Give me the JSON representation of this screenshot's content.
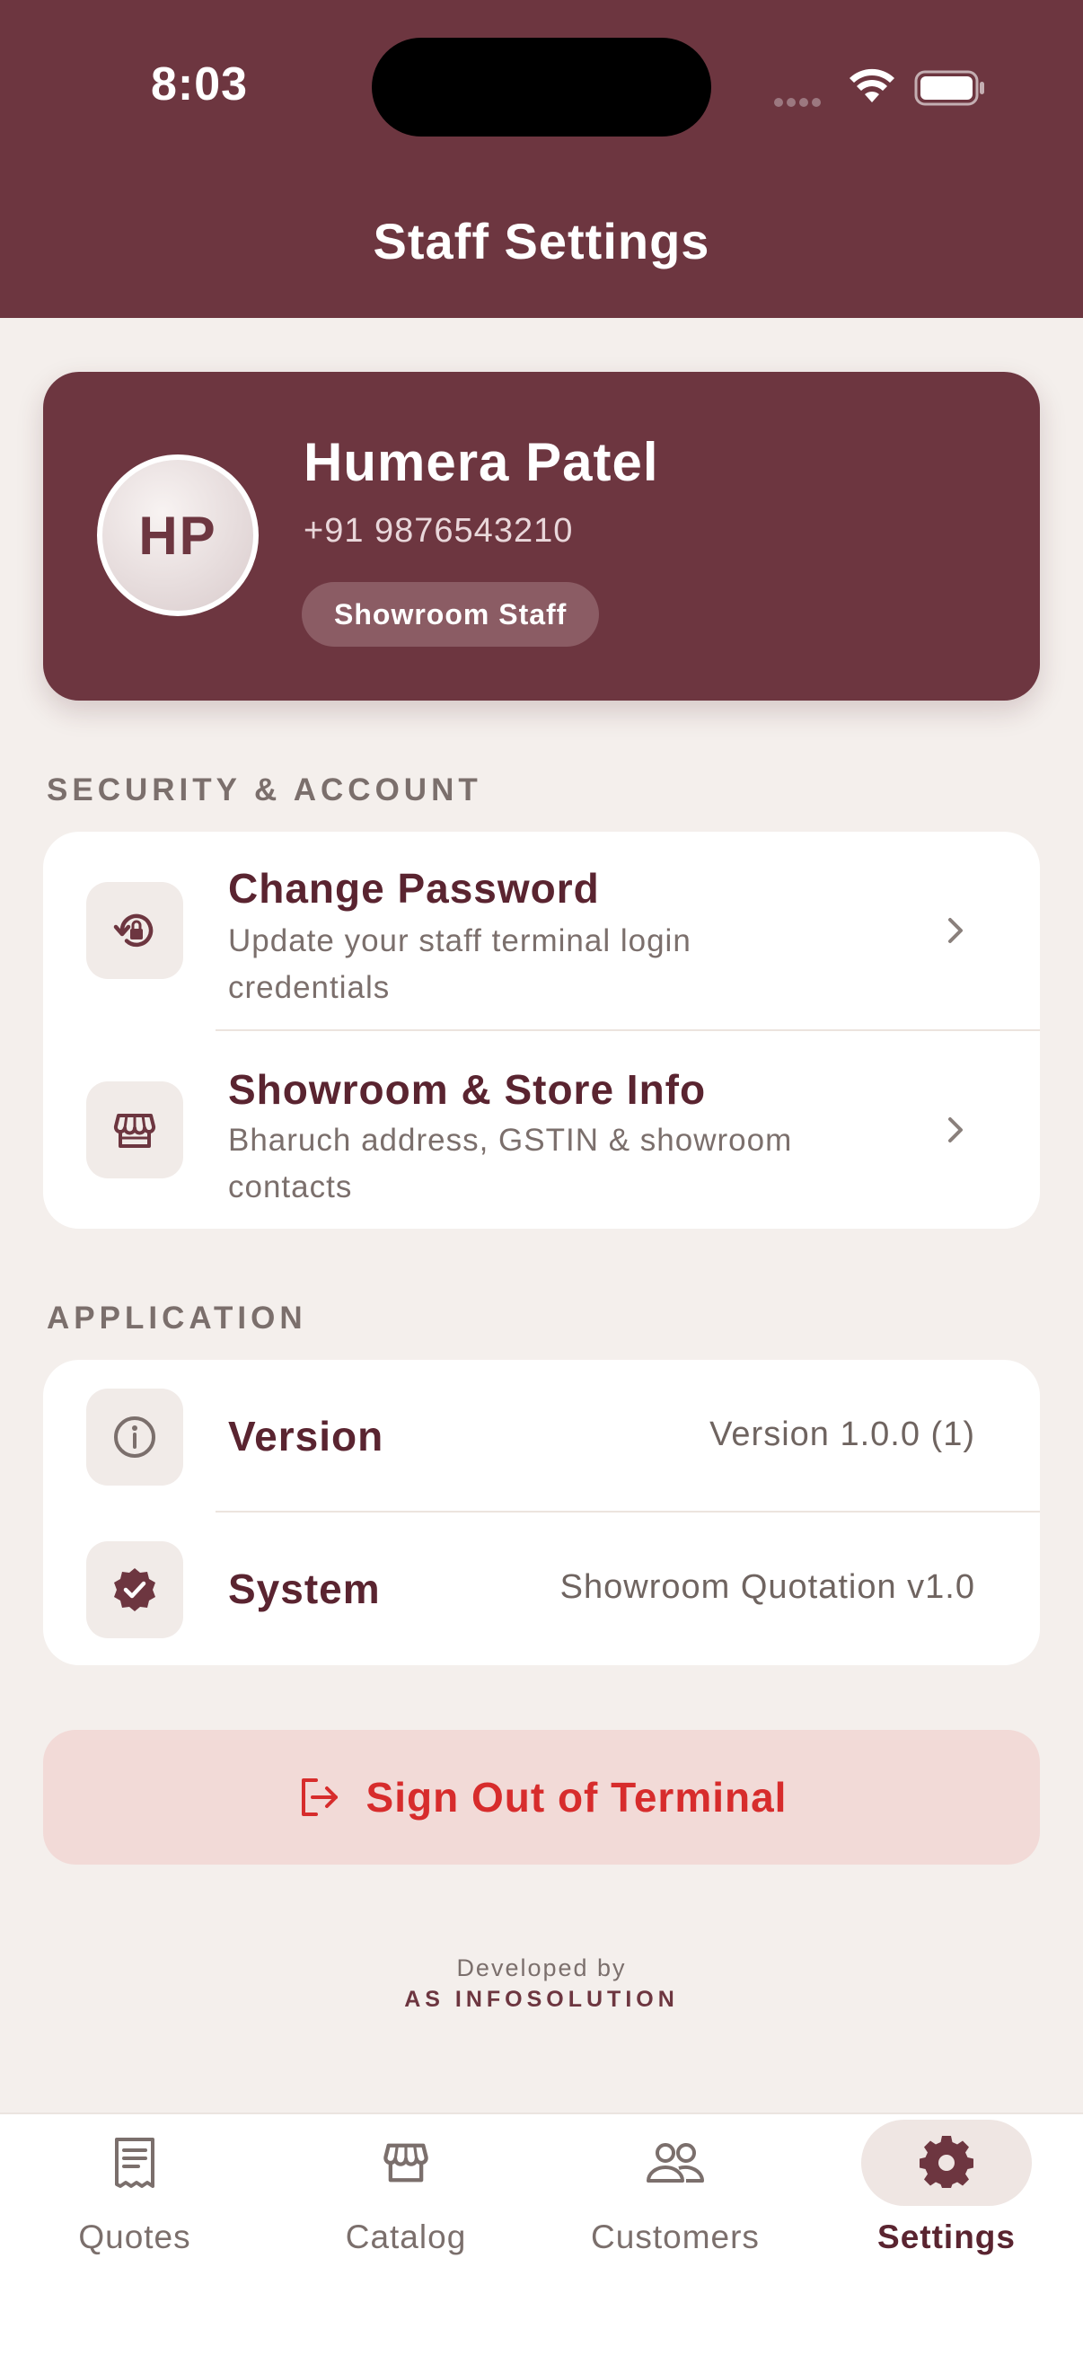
{
  "status_bar": {
    "time": "8:03"
  },
  "header": {
    "title": "Staff Settings"
  },
  "profile": {
    "initials": "HP",
    "name": "Humera Patel",
    "phone": "+91 9876543210",
    "role": "Showroom Staff"
  },
  "sections": {
    "security": {
      "label": "SECURITY & ACCOUNT",
      "items": [
        {
          "icon": "lock-reset-icon",
          "title": "Change Password",
          "subtitle": "Update your staff terminal login credentials"
        },
        {
          "icon": "store-icon",
          "title": "Showroom & Store Info",
          "subtitle": "Bharuch address, GSTIN & showroom contacts"
        }
      ]
    },
    "application": {
      "label": "APPLICATION",
      "items": [
        {
          "icon": "info-icon",
          "title": "Version",
          "value": "Version 1.0.0 (1)"
        },
        {
          "icon": "verified-badge-icon",
          "title": "System",
          "value": "Showroom Quotation v1.0"
        }
      ]
    }
  },
  "signout": {
    "icon": "logout-icon",
    "label": "Sign Out of Terminal"
  },
  "footer": {
    "developed_by": "Developed by",
    "company": "AS INFOSOLUTION"
  },
  "tabs": [
    {
      "icon": "receipt-icon",
      "label": "Quotes",
      "active": false
    },
    {
      "icon": "store-icon",
      "label": "Catalog",
      "active": false
    },
    {
      "icon": "people-icon",
      "label": "Customers",
      "active": false
    },
    {
      "icon": "gear-icon",
      "label": "Settings",
      "active": true
    }
  ],
  "colors": {
    "brand": "#6d3640",
    "background": "#f4efec",
    "danger": "#d72c2c",
    "danger_bg": "#f2dad7"
  }
}
